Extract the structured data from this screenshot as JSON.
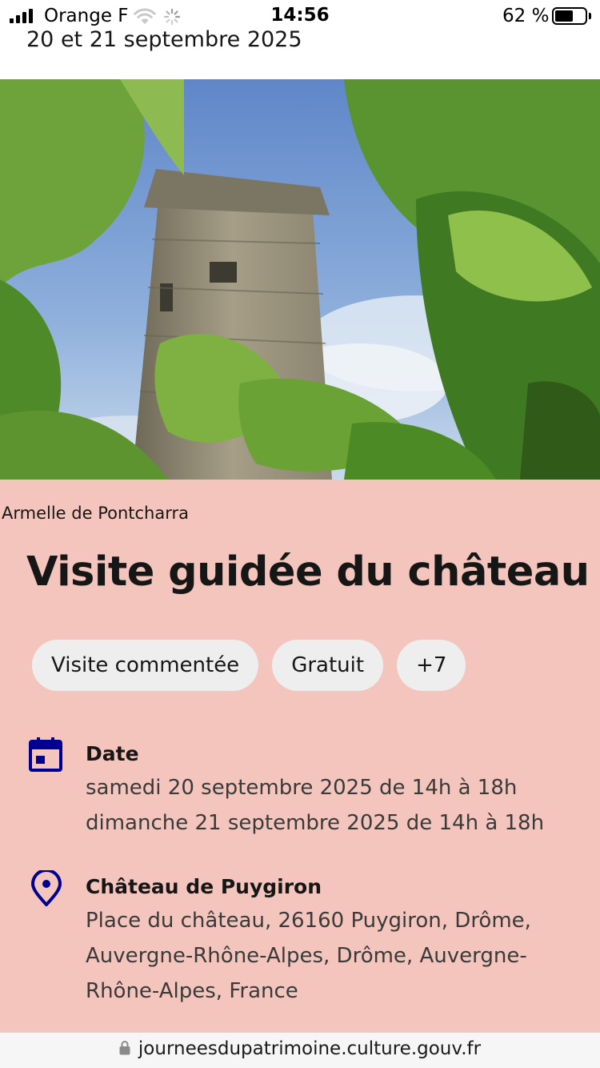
{
  "status_bar": {
    "carrier": "Orange F",
    "time": "14:56",
    "battery_percent": "62 %",
    "battery_level": 0.62
  },
  "header": {
    "date_range": "20 et 21 septembre 2025"
  },
  "hero": {
    "photo_credit": "Armelle de Pontcharra"
  },
  "event": {
    "title": "Visite guidée du château",
    "tags": [
      "Visite commentée",
      "Gratuit",
      "+7"
    ],
    "date": {
      "heading": "Date",
      "lines": [
        "samedi 20 septembre 2025 de 14h à 18h",
        "dimanche 21 septembre 2025 de 14h à 18h"
      ]
    },
    "location": {
      "heading": "Château de Puygiron",
      "address_lines": [
        "Place du château, 26160 Puygiron, Drôme,",
        "Auvergne-Rhône-Alpes, Drôme, Auvergne-",
        "Rhône-Alpes, France"
      ]
    }
  },
  "browser": {
    "url": "journeesdupatrimoine.culture.gouv.fr"
  },
  "colors": {
    "accent_blue": "#000091",
    "card_background": "#f4c5bc",
    "tag_background": "#eeeeee"
  },
  "icons": {
    "date": "calendar-icon",
    "location": "map-pin-icon",
    "url": "lock-icon"
  }
}
